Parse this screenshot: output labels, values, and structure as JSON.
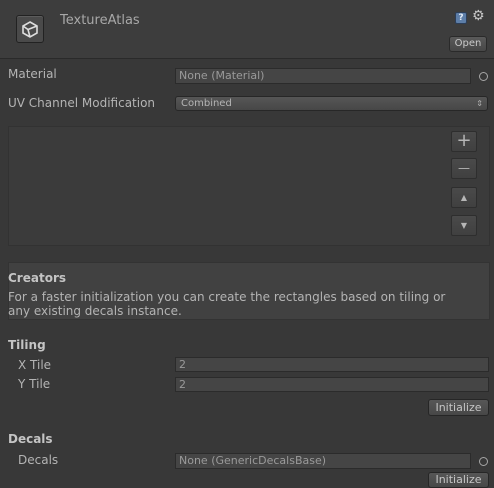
{
  "header": {
    "title": "TextureAtlas",
    "open_label": "Open",
    "help_glyph": "?",
    "gear_glyph": "⚙",
    "asset_icon": "unity-logo-icon"
  },
  "material": {
    "label": "Material",
    "value": "None (Material)"
  },
  "uv": {
    "label": "UV Channel Modification",
    "value": "Combined",
    "arrow": "⇕"
  },
  "list_buttons": {
    "add": "+",
    "remove": "—",
    "up": "▲",
    "down": "▼"
  },
  "creators": {
    "title": "Creators",
    "line1": "For a faster initialization you can create the rectangles based on tiling or",
    "line2": "any existing decals instance."
  },
  "tiling": {
    "title": "Tiling",
    "x_label": "X Tile",
    "x_value": "2",
    "y_label": "Y Tile",
    "y_value": "2",
    "initialize_label": "Initialize"
  },
  "decals": {
    "title": "Decals",
    "label": "Decals",
    "value": "None (GenericDecalsBase)",
    "initialize_label": "Initialize"
  },
  "colors": {
    "background": "#383838",
    "header": "#3d3d3d",
    "field": "#454545",
    "text": "#b4b4b4"
  }
}
